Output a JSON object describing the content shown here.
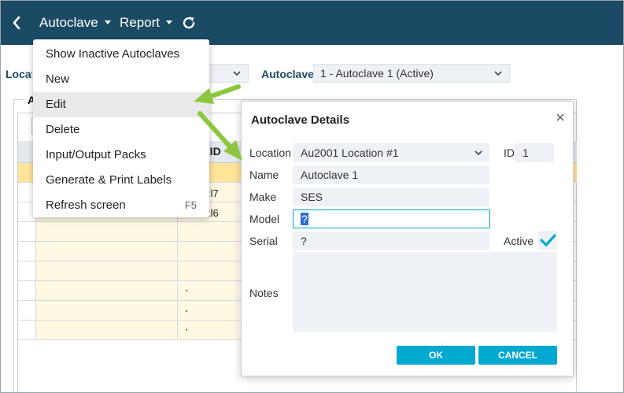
{
  "topbar": {
    "menu_autoclave": "Autoclave",
    "menu_report": "Report"
  },
  "filters": {
    "location_label": "Location",
    "autoclave_label": "Autoclave",
    "autoclave_value": "1 - Autoclave 1 (Active)"
  },
  "panel": {
    "tab_label": "A",
    "header_id": "e ID",
    "row2_fragment": ":l7",
    "row3_fragment": ":l6"
  },
  "menu": {
    "items": [
      {
        "label": "Show Inactive Autoclaves"
      },
      {
        "label": "New"
      },
      {
        "label": "Edit"
      },
      {
        "label": "Delete"
      },
      {
        "label": "Input/Output Packs"
      },
      {
        "label": "Generate & Print Labels"
      },
      {
        "label": "Refresh screen",
        "shortcut": "F5"
      }
    ]
  },
  "dialog": {
    "title": "Autoclave Details",
    "location_label": "Location",
    "location_value": "Au2001 Location #1",
    "id_label": "ID",
    "id_value": "1",
    "name_label": "Name",
    "name_value": "Autoclave 1",
    "make_label": "Make",
    "make_value": "SES",
    "model_label": "Model",
    "model_value": "?",
    "serial_label": "Serial",
    "serial_value": "?",
    "active_label": "Active",
    "active_checked": true,
    "notes_label": "Notes",
    "notes_value": "",
    "ok_label": "OK",
    "cancel_label": "CANCEL"
  },
  "colors": {
    "topbar": "#1b4a64",
    "accent": "#00a9cf",
    "arrow": "#8cc63f",
    "row_highlight": "#ffe49a"
  }
}
